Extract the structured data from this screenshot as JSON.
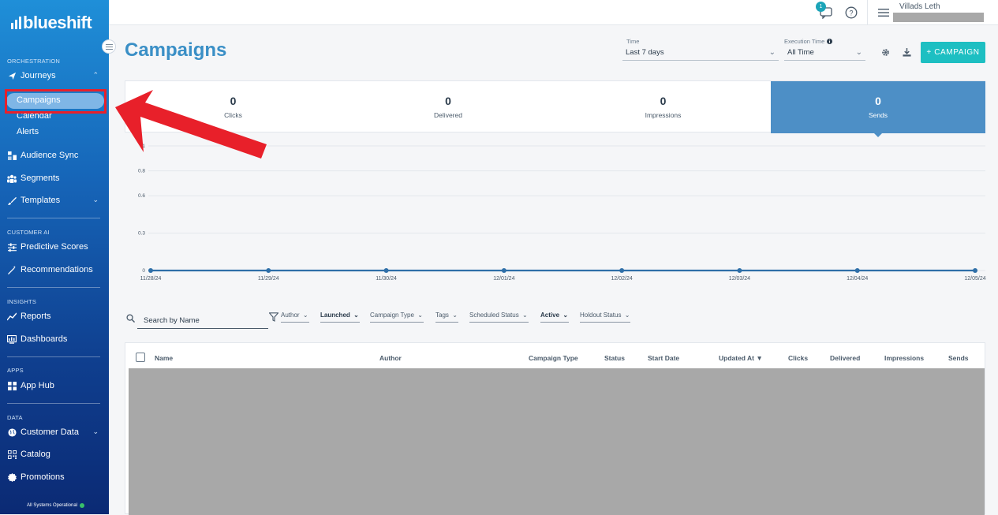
{
  "brand": {
    "logo_text": "blueshift"
  },
  "sidebar": {
    "sections": {
      "orchestration": "ORCHESTRATION",
      "customer_ai": "CUSTOMER AI",
      "insights": "INSIGHTS",
      "apps": "APPS",
      "data": "DATA"
    },
    "items": {
      "journeys": "Journeys",
      "campaigns": "Campaigns",
      "calendar": "Calendar",
      "alerts": "Alerts",
      "audience_sync": "Audience Sync",
      "segments": "Segments",
      "templates": "Templates",
      "predictive_scores": "Predictive Scores",
      "recommendations": "Recommendations",
      "reports": "Reports",
      "dashboards": "Dashboards",
      "app_hub": "App Hub",
      "customer_data": "Customer Data",
      "catalog": "Catalog",
      "promotions": "Promotions"
    },
    "status": "All Systems Operational"
  },
  "topbar": {
    "notification_count": "1",
    "user_name": "Villads Leth"
  },
  "header": {
    "title": "Campaigns",
    "time_label": "Time",
    "time_value": "Last 7 days",
    "execution_label": "Execution Time",
    "execution_value": "All Time",
    "add_button": "+ CAMPAIGN"
  },
  "stats": [
    {
      "value": "0",
      "label": "Clicks"
    },
    {
      "value": "0",
      "label": "Delivered"
    },
    {
      "value": "0",
      "label": "Impressions"
    },
    {
      "value": "0",
      "label": "Sends"
    }
  ],
  "chart_data": {
    "type": "line",
    "x": [
      "11/28/24",
      "11/29/24",
      "11/30/24",
      "12/01/24",
      "12/02/24",
      "12/03/24",
      "12/04/24",
      "12/05/24"
    ],
    "series": [
      {
        "values": [
          0,
          0,
          0,
          0,
          0,
          0,
          0,
          0
        ]
      }
    ],
    "y_ticks": [
      "1",
      "0.8",
      "0.6",
      "0.3",
      "0"
    ],
    "ylim": [
      0,
      1
    ],
    "grid": true,
    "color": "#2f6fa8"
  },
  "filters": {
    "search_placeholder": "Search by Name",
    "author": "Author",
    "launched": "Launched",
    "campaign_type": "Campaign Type",
    "tags": "Tags",
    "scheduled_status": "Scheduled Status",
    "active": "Active",
    "holdout_status": "Holdout Status"
  },
  "table": {
    "columns": {
      "name": "Name",
      "author": "Author",
      "campaign_type": "Campaign Type",
      "status": "Status",
      "start_date": "Start Date",
      "updated_at": "Updated At ▼",
      "clicks": "Clicks",
      "delivered": "Delivered",
      "impressions": "Impressions",
      "sends": "Sends"
    }
  }
}
